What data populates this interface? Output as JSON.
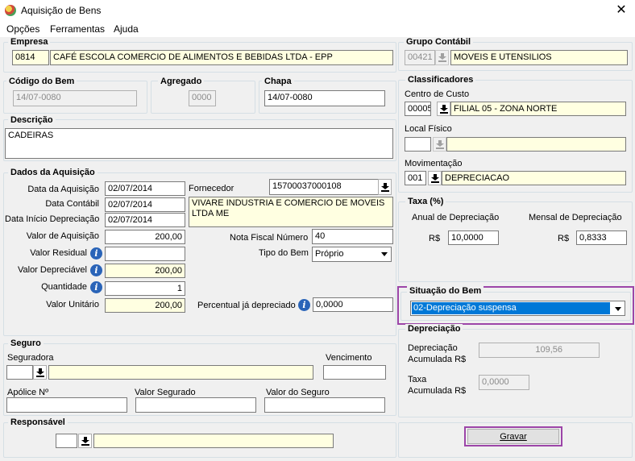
{
  "window": {
    "title": "Aquisição de Bens",
    "close_icon": "close-icon"
  },
  "menu": {
    "items": [
      "Opções",
      "Ferramentas",
      "Ajuda"
    ]
  },
  "empresa": {
    "legend": "Empresa",
    "code": "0814",
    "name": "CAFÉ ESCOLA COMERCIO DE ALIMENTOS E BEBIDAS LTDA - EPP"
  },
  "codigo_bem": {
    "legend": "Código do Bem",
    "value": "14/07-0080"
  },
  "agregado": {
    "legend": "Agregado",
    "value": "0000"
  },
  "chapa": {
    "legend": "Chapa",
    "value": "14/07-0080"
  },
  "descricao": {
    "legend": "Descrição",
    "value": "CADEIRAS"
  },
  "aquisicao": {
    "legend": "Dados da Aquisição",
    "data_aquisicao_label": "Data da Aquisição",
    "data_aquisicao": "02/07/2014",
    "data_contabil_label": "Data Contábil",
    "data_contabil": "02/07/2014",
    "data_inicio_label": "Data Início Depreciação",
    "data_inicio": "02/07/2014",
    "valor_aquisicao_label": "Valor de Aquisição",
    "valor_aquisicao": "200,00",
    "valor_residual_label": "Valor Residual",
    "valor_residual": "",
    "valor_depreciavel_label": "Valor Depreciável",
    "valor_depreciavel": "200,00",
    "quantidade_label": "Quantidade",
    "quantidade": "1",
    "valor_unitario_label": "Valor Unitário",
    "valor_unitario": "200,00",
    "fornecedor_label": "Fornecedor",
    "fornecedor_code": "15700037000108",
    "fornecedor_name": "VIVARE INDUSTRIA E COMERCIO DE MOVEIS LTDA ME",
    "nota_fiscal_label": "Nota Fiscal Número",
    "nota_fiscal": "40",
    "tipo_bem_label": "Tipo do Bem",
    "tipo_bem": "Próprio",
    "percentual_label": "Percentual já depreciado",
    "percentual": "0,0000"
  },
  "seguro": {
    "legend": "Seguro",
    "seguradora_label": "Seguradora",
    "seguradora_code": "",
    "seguradora_name": "",
    "vencimento_label": "Vencimento",
    "vencimento": "",
    "apolice_label": "Apólice Nº",
    "apolice": "",
    "valor_segurado_label": "Valor Segurado",
    "valor_segurado": "",
    "valor_seguro_label": "Valor do Seguro",
    "valor_seguro": ""
  },
  "responsavel": {
    "legend": "Responsável",
    "code": "",
    "name": ""
  },
  "grupo_contabil": {
    "legend": "Grupo Contábil",
    "code": "00421",
    "name": "MOVEIS E UTENSILIOS"
  },
  "classificadores": {
    "legend": "Classificadores",
    "centro_custo_label": "Centro de Custo",
    "centro_custo_code": "00005",
    "centro_custo_name": "FILIAL 05 - ZONA NORTE",
    "local_fisico_label": "Local Físico",
    "local_fisico_code": "",
    "local_fisico_name": "",
    "movimentacao_label": "Movimentação",
    "movimentacao_code": "001",
    "movimentacao_name": "DEPRECIACAO"
  },
  "taxa": {
    "legend": "Taxa (%)",
    "anual_label": "Anual de Depreciação",
    "anual_currency": "R$",
    "anual": "10,0000",
    "mensal_label": "Mensal de Depreciação",
    "mensal_currency": "R$",
    "mensal": "0,8333"
  },
  "situacao": {
    "legend": "Situação do Bem",
    "selected": "02-Depreciação suspensa"
  },
  "depreciacao": {
    "legend": "Depreciação",
    "acumulada_label_1": "Depreciação",
    "acumulada_label_2": "Acumulada R$",
    "acumulada": "109,56",
    "taxa_label_1": "Taxa",
    "taxa_label_2": "Acumulada R$",
    "taxa": "0,0000"
  },
  "actions": {
    "save": "Gravar"
  },
  "colors": {
    "field_yellow": "#ffffe1",
    "highlight": "#9c45a8",
    "selection": "#0078d7"
  }
}
